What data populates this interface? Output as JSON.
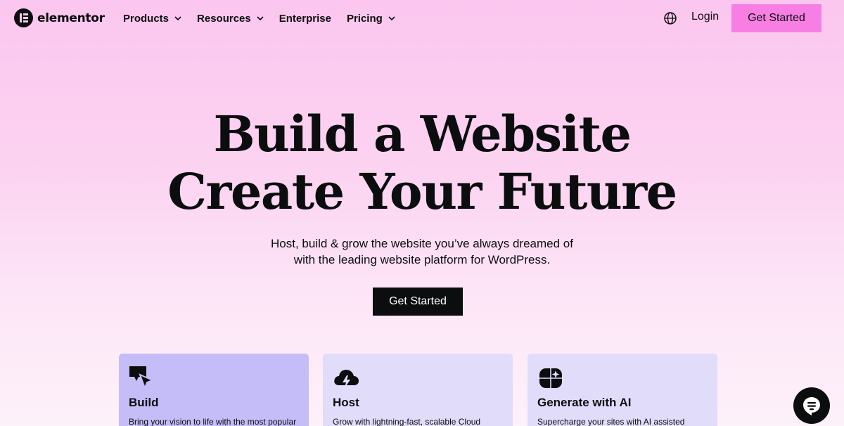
{
  "header": {
    "logo_text": "elementor",
    "nav": [
      {
        "label": "Products",
        "has_dropdown": true
      },
      {
        "label": "Resources",
        "has_dropdown": true
      },
      {
        "label": "Enterprise",
        "has_dropdown": false
      },
      {
        "label": "Pricing",
        "has_dropdown": true
      }
    ],
    "language_icon": "globe-icon",
    "login_label": "Login",
    "cta_label": "Get Started"
  },
  "hero": {
    "title_line1": "Build a Website",
    "title_line2": "Create Your Future",
    "subtitle_line1": "Host, build & grow the website you’ve always dreamed of",
    "subtitle_line2": "with the leading website platform for WordPress.",
    "cta_label": "Get Started"
  },
  "cards": [
    {
      "icon": "cursor-click-icon",
      "title": "Build",
      "description": "Bring your vision to life with the most popular"
    },
    {
      "icon": "cloud-bolt-icon",
      "title": "Host",
      "description": "Grow with lightning-fast, scalable Cloud"
    },
    {
      "icon": "ai-sparkle-icon",
      "title": "Generate with AI",
      "description": "Supercharge your sites with AI assisted"
    }
  ],
  "chat_icon": "chat-icon",
  "colors": {
    "background_top": "#fbc6ef",
    "background_bottom": "#fdf1fa",
    "header_cta": "#f77fe4",
    "hero_cta": "#0c0d0e",
    "card_build": "#c4bdf8",
    "card_other": "#e0dcfa",
    "text": "#0c0d0e"
  }
}
